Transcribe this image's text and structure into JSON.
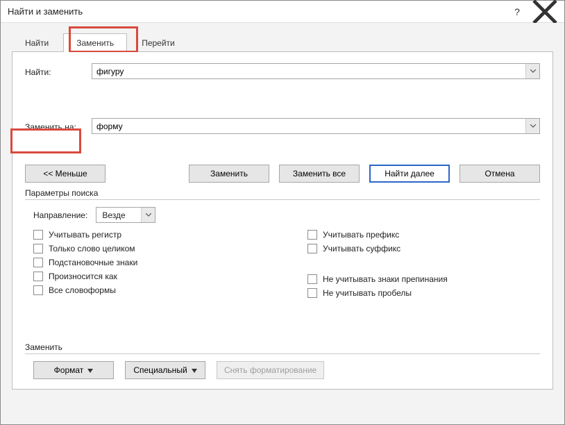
{
  "window": {
    "title": "Найти и заменить"
  },
  "tabs": {
    "find": "Найти",
    "replace": "Заменить",
    "goto": "Перейти"
  },
  "labels": {
    "find_what": "Найти:",
    "replace_with": "Заменить на:"
  },
  "fields": {
    "find_value": "фигуру",
    "replace_value": "форму"
  },
  "buttons": {
    "less": "<< Меньше",
    "replace": "Заменить",
    "replace_all": "Заменить все",
    "find_next": "Найти далее",
    "cancel": "Отмена",
    "format": "Формат",
    "special": "Специальный",
    "no_formatting": "Снять форматирование"
  },
  "params": {
    "title": "Параметры поиска",
    "direction_label": "Направление:",
    "direction_value": "Везде",
    "left": {
      "match_case": "Учитывать регистр",
      "whole_word": "Только слово целиком",
      "wildcards": "Подстановочные знаки",
      "sounds_like": "Произносится как",
      "word_forms": "Все словоформы"
    },
    "right": {
      "prefix": "Учитывать префикс",
      "suffix": "Учитывать суффикс",
      "ignore_punct": "Не учитывать знаки препинания",
      "ignore_space": "Не учитывать пробелы"
    }
  },
  "footer": {
    "replace_section": "Заменить"
  }
}
